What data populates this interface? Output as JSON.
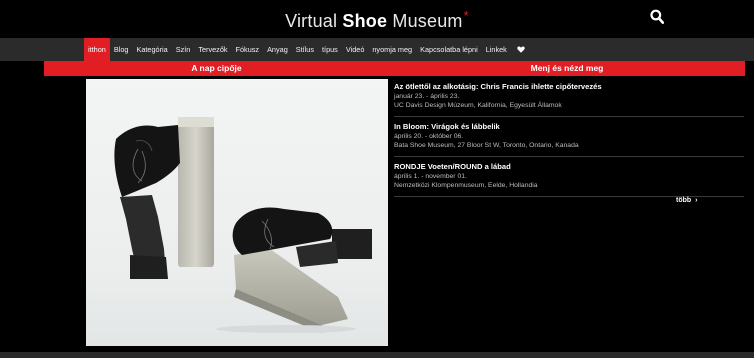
{
  "header": {
    "brand_light": "Virtual ",
    "brand_bold": "Shoe",
    "brand_rest": " Museum",
    "brand_mark": "*",
    "search_icon": "search-icon"
  },
  "nav": {
    "items": [
      "itthon",
      "Blog",
      "Kategória",
      "Szín",
      "Tervezők",
      "Fókusz",
      "Anyag",
      "Stílus",
      "típus",
      "Videó",
      "nyomja meg",
      "Kapcsolatba lépni",
      "Linkek"
    ],
    "favorite_icon": "heart-icon",
    "active_color": "#e01e24"
  },
  "left_section": {
    "title": "A nap cipője"
  },
  "right_section": {
    "title": "Menj és nézd meg"
  },
  "events": [
    {
      "title": "Az ötlettől az alkotásig: Chris Francis ihlette cipőtervezés",
      "dates": "január 23. - április 23.",
      "venue": "UC Davis Design Múzeum, Kalifornia, Egyesült Államok"
    },
    {
      "title": "In Bloom: Virágok és lábbelik",
      "dates": "április 20. - október 06.",
      "venue": "Bata Shoe Museum, 27 Bloor St W, Toronto, Ontario, Kanada"
    },
    {
      "title": "RONDJE Voeten/ROUND a lábad",
      "dates": "április 1. - november 01.",
      "venue": "Nemzetközi Klompenmuseum, Eelde, Hollandia"
    }
  ],
  "more": {
    "label": "több",
    "arrow": "›"
  },
  "colors": {
    "accent": "#e01e24",
    "nav_bg": "#2b2b2b",
    "bg": "#000000"
  }
}
